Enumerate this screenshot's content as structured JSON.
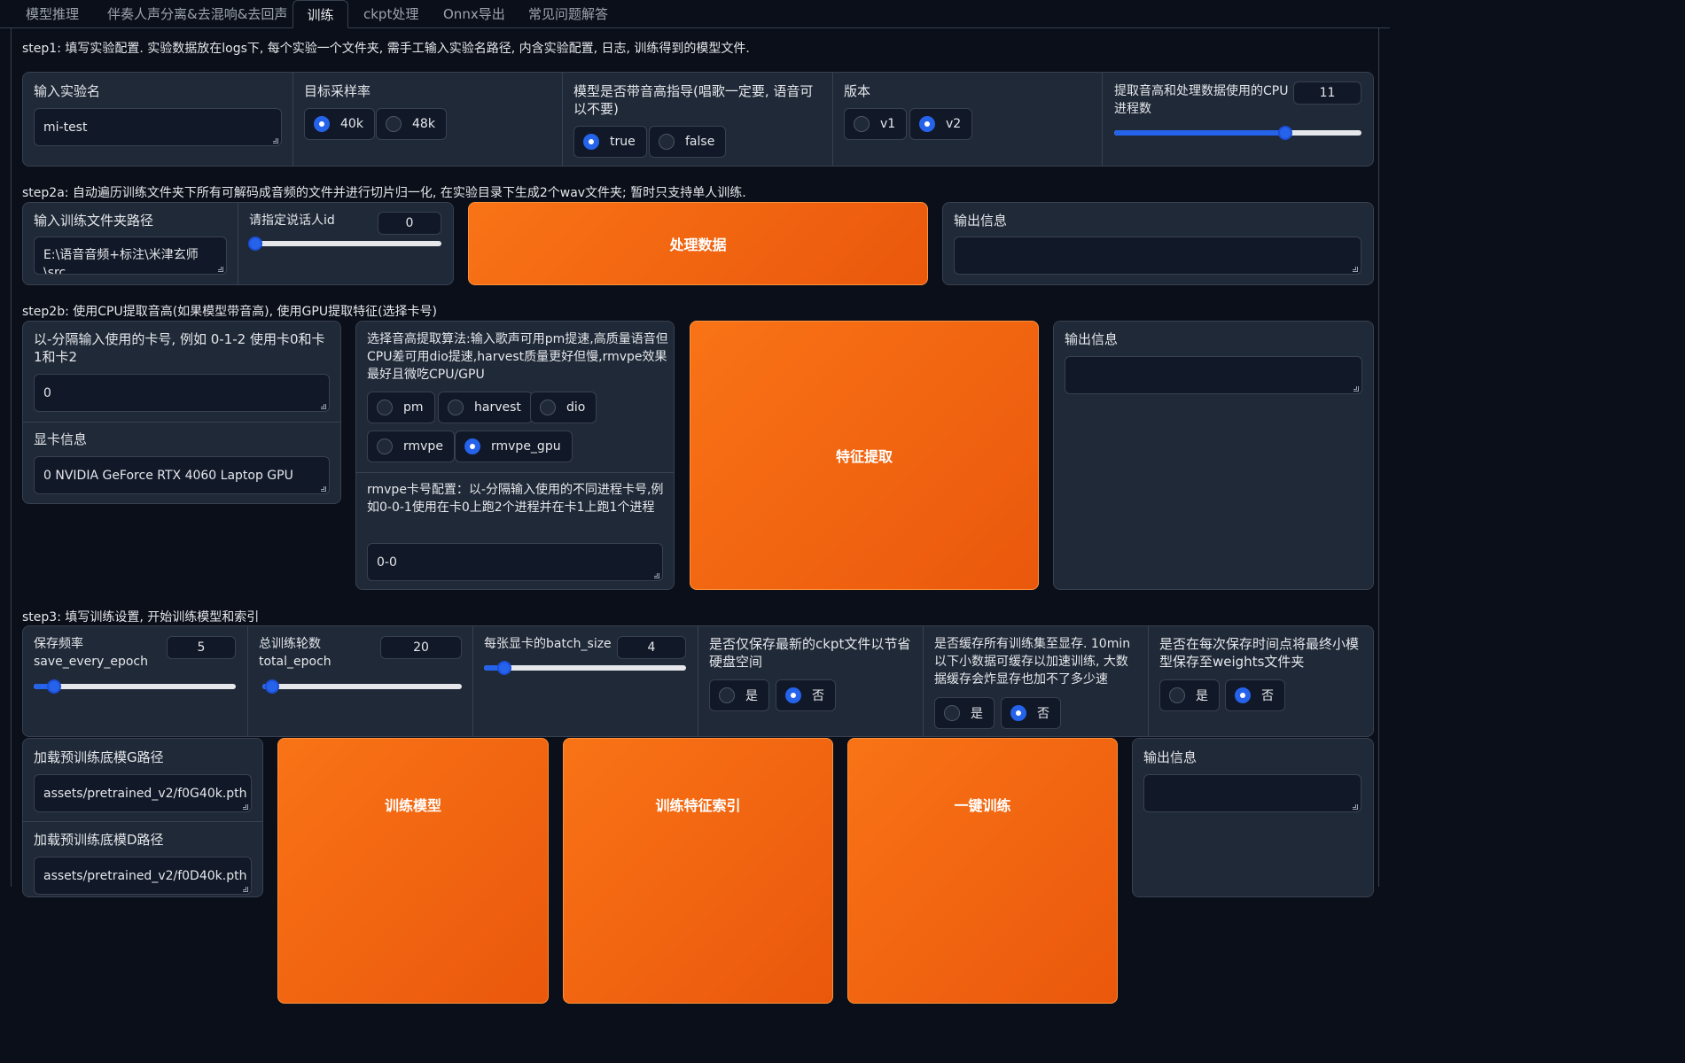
{
  "tabs": [
    "模型推理",
    "伴奏人声分离&去混响&去回声",
    "训练",
    "ckpt处理",
    "Onnx导出",
    "常见问题解答"
  ],
  "step1": {
    "title": "step1: 填写实验配置. 实验数据放在logs下, 每个实验一个文件夹, 需手工输入实验名路径, 内含实验配置, 日志, 训练得到的模型文件.",
    "exp_name_label": "输入实验名",
    "exp_name_value": "mi-test",
    "sr_label": "目标采样率",
    "sr_options": [
      "40k",
      "48k"
    ],
    "sr_selected": "40k",
    "f0_label": "模型是否带音高指导(唱歌一定要, 语音可以不要)",
    "f0_options": [
      "true",
      "false"
    ],
    "f0_selected": "true",
    "version_label": "版本",
    "version_options": [
      "v1",
      "v2"
    ],
    "version_selected": "v2",
    "cpu_label": "提取音高和处理数据使用的CPU进程数",
    "cpu_value": "11",
    "cpu_fraction": 0.69
  },
  "step2a": {
    "title": "step2a: 自动遍历训练文件夹下所有可解码成音频的文件并进行切片归一化, 在实验目录下生成2个wav文件夹; 暂时只支持单人训练.",
    "trainset_label": "输入训练文件夹路径",
    "trainset_value": "E:\\语音音频+标注\\米津玄师\\src",
    "spk_label": "请指定说话人id",
    "spk_value": "0",
    "spk_fraction": 0.0,
    "process_button": "处理数据",
    "output_label": "输出信息"
  },
  "step2b": {
    "title": "step2b: 使用CPU提取音高(如果模型带音高), 使用GPU提取特征(选择卡号)",
    "gpus_label": "以-分隔输入使用的卡号, 例如 0-1-2 使用卡0和卡1和卡2",
    "gpus_value": "0",
    "gpu_info_label": "显卡信息",
    "gpu_info_value": "0 NVIDIA GeForce RTX 4060 Laptop GPU",
    "f0_method_label": "选择音高提取算法:输入歌声可用pm提速,高质量语音但CPU差可用dio提速,harvest质量更好但慢,rmvpe效果最好且微吃CPU/GPU",
    "f0_methods": [
      "pm",
      "harvest",
      "dio",
      "rmvpe",
      "rmvpe_gpu"
    ],
    "f0_method_selected": "rmvpe_gpu",
    "rmvpe_label": "rmvpe卡号配置：以-分隔输入使用的不同进程卡号,例如0-0-1使用在卡0上跑2个进程并在卡1上跑1个进程",
    "rmvpe_value": "0-0",
    "extract_button": "特征提取",
    "output_label": "输出信息"
  },
  "step3": {
    "title": "step3: 填写训练设置, 开始训练模型和索引",
    "save_label": "保存频率\nsave_every_epoch",
    "save_value": "5",
    "save_fraction": 0.1,
    "total_label": "总训练轮数\ntotal_epoch",
    "total_value": "20",
    "total_fraction": 0.05,
    "batch_label": "每张显卡的batch_size",
    "batch_value": "4",
    "batch_fraction": 0.1,
    "latest_label": "是否仅保存最新的ckpt文件以节省硬盘空间",
    "cache_label": "是否缓存所有训练集至显存. 10min以下小数据可缓存以加速训练, 大数据缓存会炸显存也加不了多少速",
    "weights_label": "是否在每次保存时间点将最终小模型保存至weights文件夹",
    "yes": "是",
    "no": "否",
    "latest_selected": "否",
    "cache_selected": "否",
    "weights_selected": "否",
    "pretrained_g_label": "加载预训练底模G路径",
    "pretrained_g_value": "assets/pretrained_v2/f0G40k.pth",
    "pretrained_d_label": "加载预训练底模D路径",
    "pretrained_d_value": "assets/pretrained_v2/f0D40k.pth",
    "train_button": "训练模型",
    "index_button": "训练特征索引",
    "onekey_button": "一键训练",
    "output_label": "输出信息"
  }
}
